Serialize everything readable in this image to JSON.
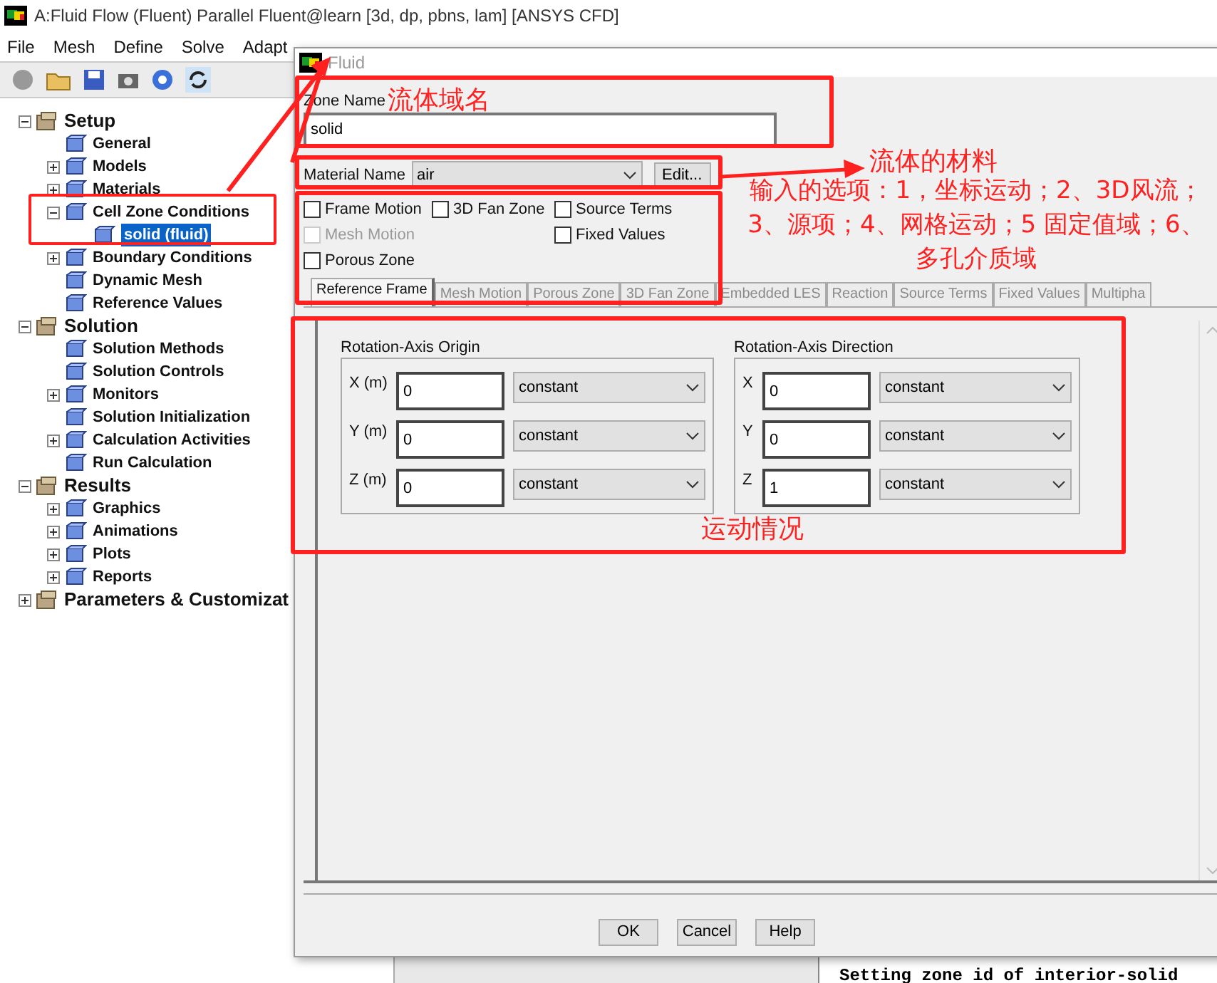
{
  "window": {
    "title": "A:Fluid Flow (Fluent) Parallel Fluent@learn  [3d, dp, pbns, lam] [ANSYS CFD]"
  },
  "menu": [
    "File",
    "Mesh",
    "Define",
    "Solve",
    "Adapt"
  ],
  "tree": [
    {
      "label": "Setup",
      "expanded": true,
      "children": [
        {
          "label": "General"
        },
        {
          "label": "Models",
          "expanded": false
        },
        {
          "label": "Materials",
          "expanded": false
        },
        {
          "label": "Cell Zone Conditions",
          "expanded": true,
          "children": [
            {
              "label": "solid (fluid)",
              "selected": true
            }
          ]
        },
        {
          "label": "Boundary Conditions",
          "expanded": false
        },
        {
          "label": "Dynamic Mesh"
        },
        {
          "label": "Reference Values"
        }
      ]
    },
    {
      "label": "Solution",
      "expanded": true,
      "children": [
        {
          "label": "Solution Methods"
        },
        {
          "label": "Solution Controls"
        },
        {
          "label": "Monitors",
          "expanded": false
        },
        {
          "label": "Solution Initialization"
        },
        {
          "label": "Calculation Activities",
          "expanded": false
        },
        {
          "label": "Run Calculation"
        }
      ]
    },
    {
      "label": "Results",
      "expanded": true,
      "children": [
        {
          "label": "Graphics",
          "expanded": false
        },
        {
          "label": "Animations",
          "expanded": false
        },
        {
          "label": "Plots",
          "expanded": false
        },
        {
          "label": "Reports",
          "expanded": false
        }
      ]
    },
    {
      "label": "Parameters & Customizat",
      "expanded": false
    }
  ],
  "console": {
    "text": "Setting zone id of interior-solid"
  },
  "dialog": {
    "title": "Fluid",
    "zone_name": {
      "label": "Zone Name",
      "value": "solid"
    },
    "material": {
      "label": "Material Name",
      "value": "air",
      "button": "Edit..."
    },
    "option_columns": [
      [
        {
          "label": "Frame Motion",
          "checked": false,
          "disabled": false
        },
        {
          "label": "Mesh Motion",
          "checked": false,
          "disabled": true
        },
        {
          "label": "Porous Zone",
          "checked": false,
          "disabled": false
        }
      ],
      [
        {
          "label": "3D Fan Zone",
          "checked": false,
          "disabled": false
        }
      ],
      [
        {
          "label": "Source Terms",
          "checked": false,
          "disabled": false
        },
        {
          "label": "Fixed Values",
          "checked": false,
          "disabled": false
        }
      ]
    ],
    "tabs": [
      {
        "label": "Reference Frame",
        "selected": true,
        "disabled": false
      },
      {
        "label": "Mesh Motion",
        "selected": false,
        "disabled": true
      },
      {
        "label": "Porous Zone",
        "selected": false,
        "disabled": true
      },
      {
        "label": "3D Fan Zone",
        "selected": false,
        "disabled": true
      },
      {
        "label": "Embedded LES",
        "selected": false,
        "disabled": true
      },
      {
        "label": "Reaction",
        "selected": false,
        "disabled": true
      },
      {
        "label": "Source Terms",
        "selected": false,
        "disabled": true
      },
      {
        "label": "Fixed Values",
        "selected": false,
        "disabled": true
      },
      {
        "label": "Multipha",
        "selected": false,
        "disabled": true
      }
    ],
    "groups": [
      {
        "title": "Rotation-Axis Origin",
        "rows": [
          {
            "label": "X (m)",
            "value": "0",
            "method": "constant"
          },
          {
            "label": "Y (m)",
            "value": "0",
            "method": "constant"
          },
          {
            "label": "Z (m)",
            "value": "0",
            "method": "constant"
          }
        ]
      },
      {
        "title": "Rotation-Axis Direction",
        "rows": [
          {
            "label": "X",
            "value": "0",
            "method": "constant"
          },
          {
            "label": "Y",
            "value": "0",
            "method": "constant"
          },
          {
            "label": "Z",
            "value": "1",
            "method": "constant"
          }
        ]
      }
    ],
    "buttons": [
      "OK",
      "Cancel",
      "Help"
    ]
  },
  "annotations": [
    {
      "kind": "zone",
      "text": "流体域名"
    },
    {
      "kind": "material",
      "text": "流体的材料"
    },
    {
      "kind": "options",
      "text": "输入的选项：1，坐标运动；2、3D风流；3、源项；4、网格运动；5 固定值域；6、多孔介质域"
    },
    {
      "kind": "motion",
      "text": "运动情况"
    }
  ]
}
